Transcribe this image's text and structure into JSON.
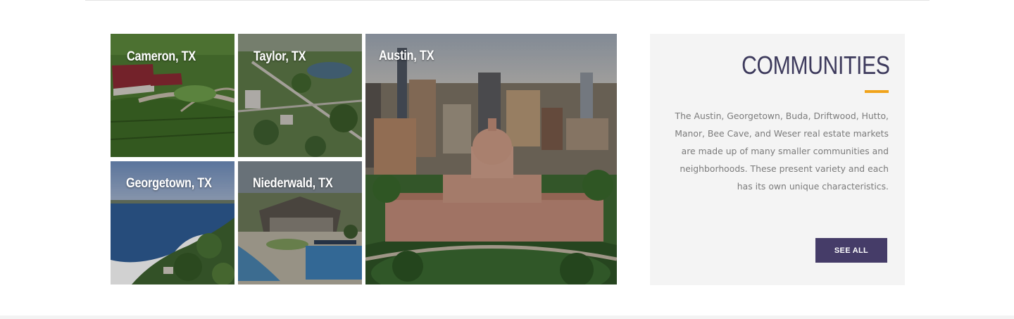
{
  "communities_grid": {
    "tiles": [
      {
        "id": "cameron",
        "label": "Cameron, TX"
      },
      {
        "id": "taylor",
        "label": "Taylor, TX"
      },
      {
        "id": "austin",
        "label": "Austin, TX"
      },
      {
        "id": "georgetown",
        "label": "Georgetown, TX"
      },
      {
        "id": "niederwald",
        "label": "Niederwald, TX"
      }
    ]
  },
  "panel": {
    "title": "COMMUNITIES",
    "description": "The Austin, Georgetown, Buda, Driftwood, Hutto, Manor, Bee Cave, and Weser real estate markets are made up of many smaller communities and neighborhoods. These present variety and each has its own unique characteristics.",
    "button_label": "SEE ALL"
  },
  "colors": {
    "accent": "#f0a31b",
    "title": "#3d3a5c",
    "button": "#453c68",
    "panel_bg": "#f4f4f4"
  }
}
